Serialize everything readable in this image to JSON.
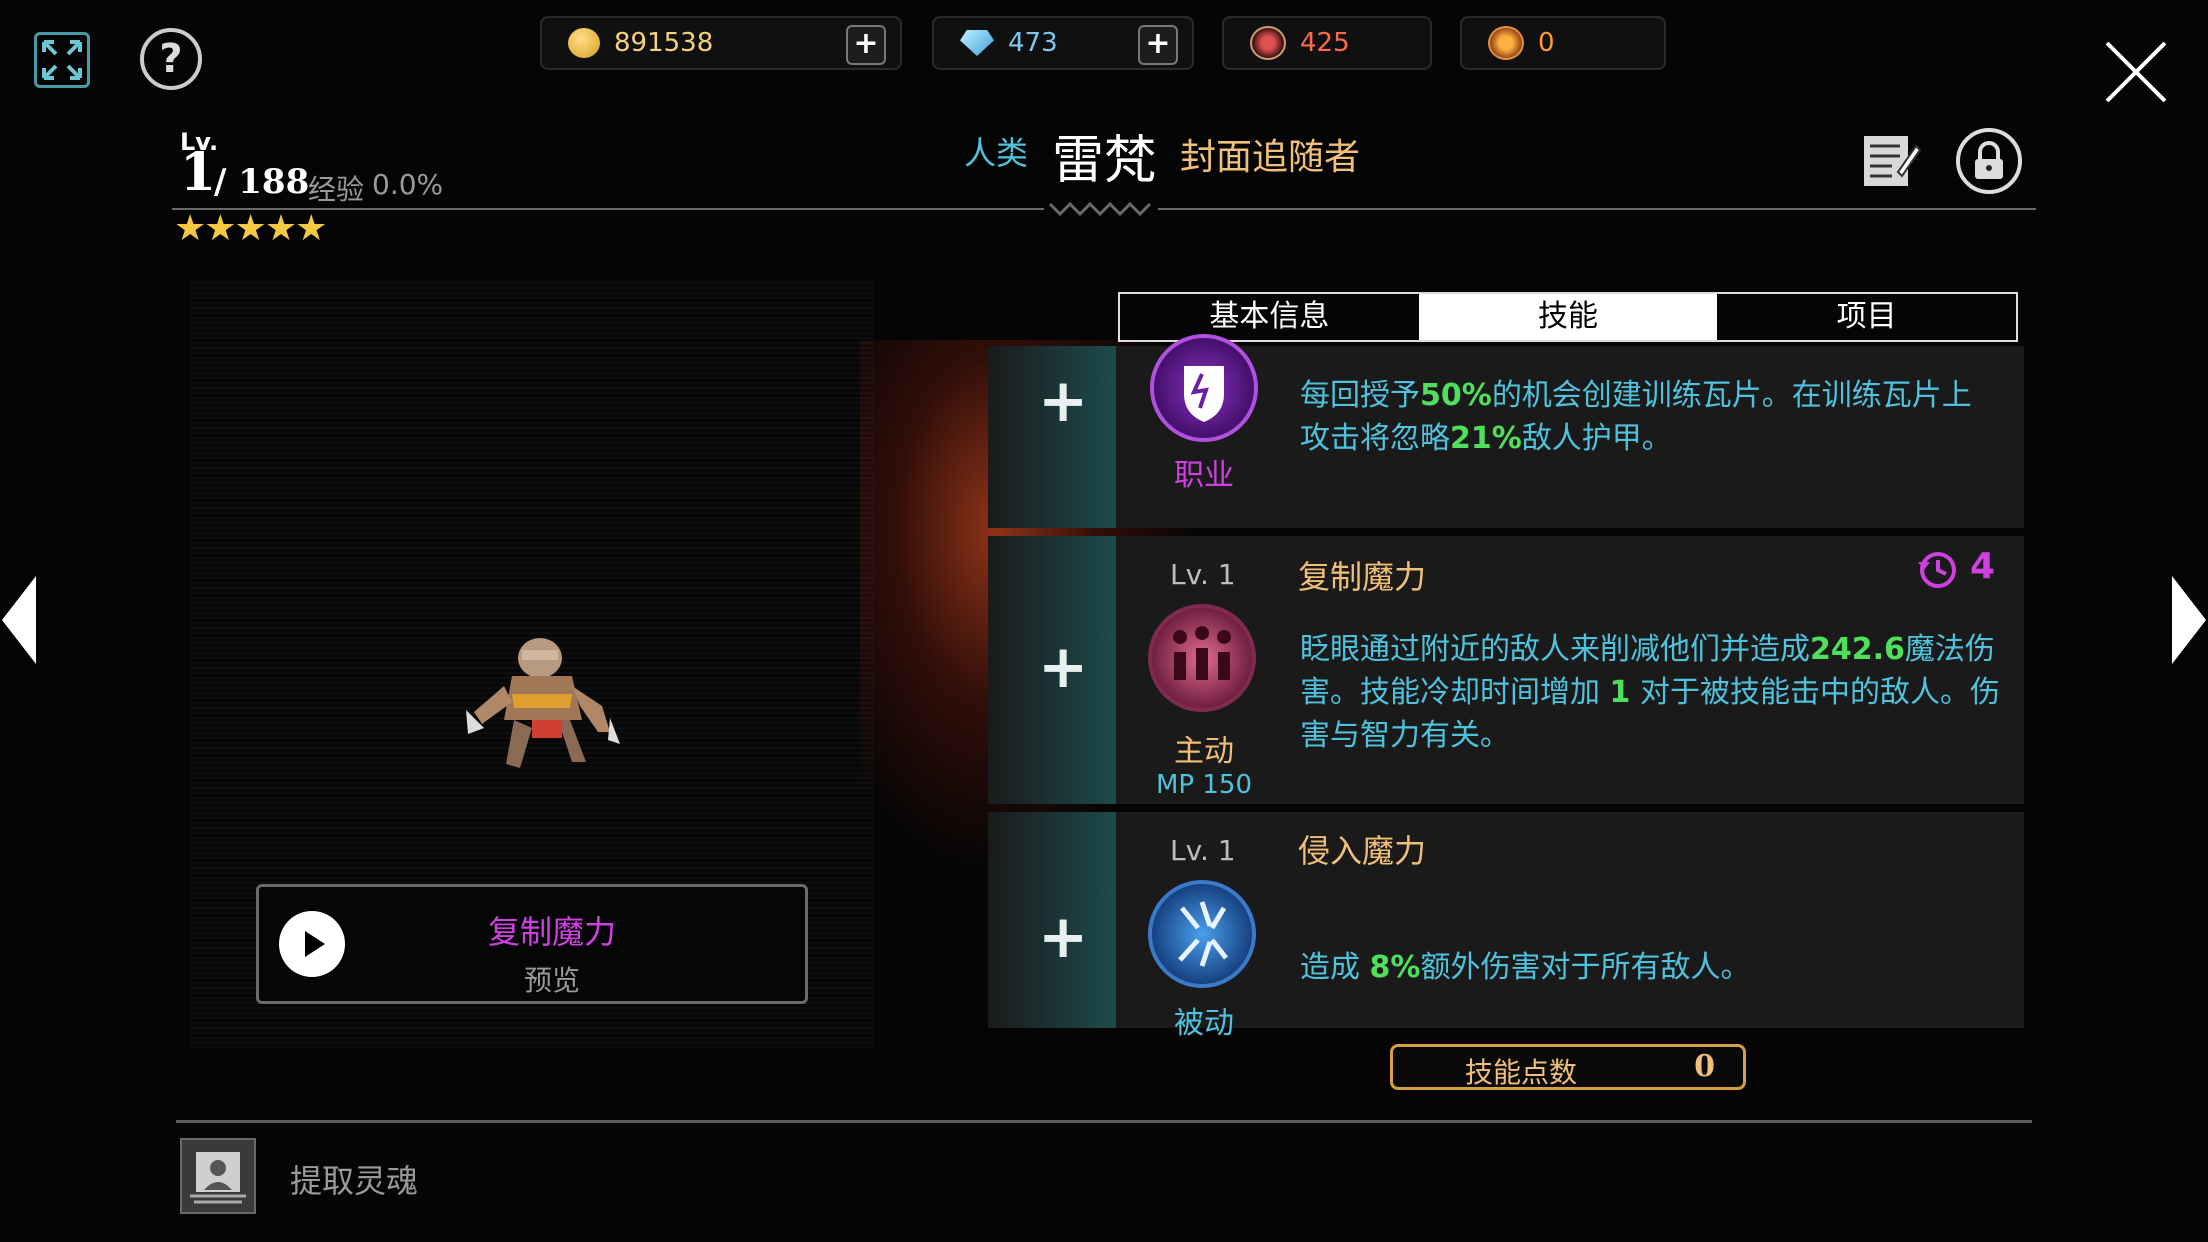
{
  "topbar": {
    "gold": "891538",
    "gems": "473",
    "currency3": "425",
    "currency4": "0",
    "plus": "+"
  },
  "hero": {
    "lv_label": "Lv.",
    "level": "1",
    "max_level": "/ 188",
    "exp_label": "经验",
    "exp_value": "0.0%",
    "stars": "★★★★★",
    "race": "人类",
    "name": "雷梵",
    "title": "封面追随者"
  },
  "tabs": [
    {
      "label": "基本信息",
      "active": false
    },
    {
      "label": "技能",
      "active": true
    },
    {
      "label": "项目",
      "active": false
    }
  ],
  "skills": [
    {
      "type": "职业",
      "desc_parts": [
        "每回授予",
        "50%",
        "的机会创建训练瓦片。在训练瓦片上攻击将忽略",
        "21%",
        "敌人护甲。"
      ]
    },
    {
      "level": "Lv. 1",
      "name": "复制魔力",
      "type": "主动",
      "mp": "MP 150",
      "cooldown": "4",
      "desc_parts": [
        "眨眼通过附近的敌人来削减他们并造成",
        "242.6",
        "魔法伤害。技能冷却时间增加",
        "1",
        "对于被技能击中的敌人。伤害与智力有关。"
      ]
    },
    {
      "level": "Lv. 1",
      "name": "侵入魔力",
      "type": "被动",
      "desc_parts": [
        "造成",
        "8%",
        "额外伤害对于所有敌人。"
      ]
    }
  ],
  "plus_label": "+",
  "preview": {
    "skill_name": "复制魔力",
    "label": "预览"
  },
  "skill_points": {
    "label": "技能点数",
    "value": "0"
  },
  "footer": {
    "extract_label": "提取灵魂"
  },
  "colors": {
    "accent_gold": "#f0c078",
    "desc_cyan": "#4fc3dd",
    "highlight_green": "#4ee05a",
    "magenta": "#d040e0"
  }
}
